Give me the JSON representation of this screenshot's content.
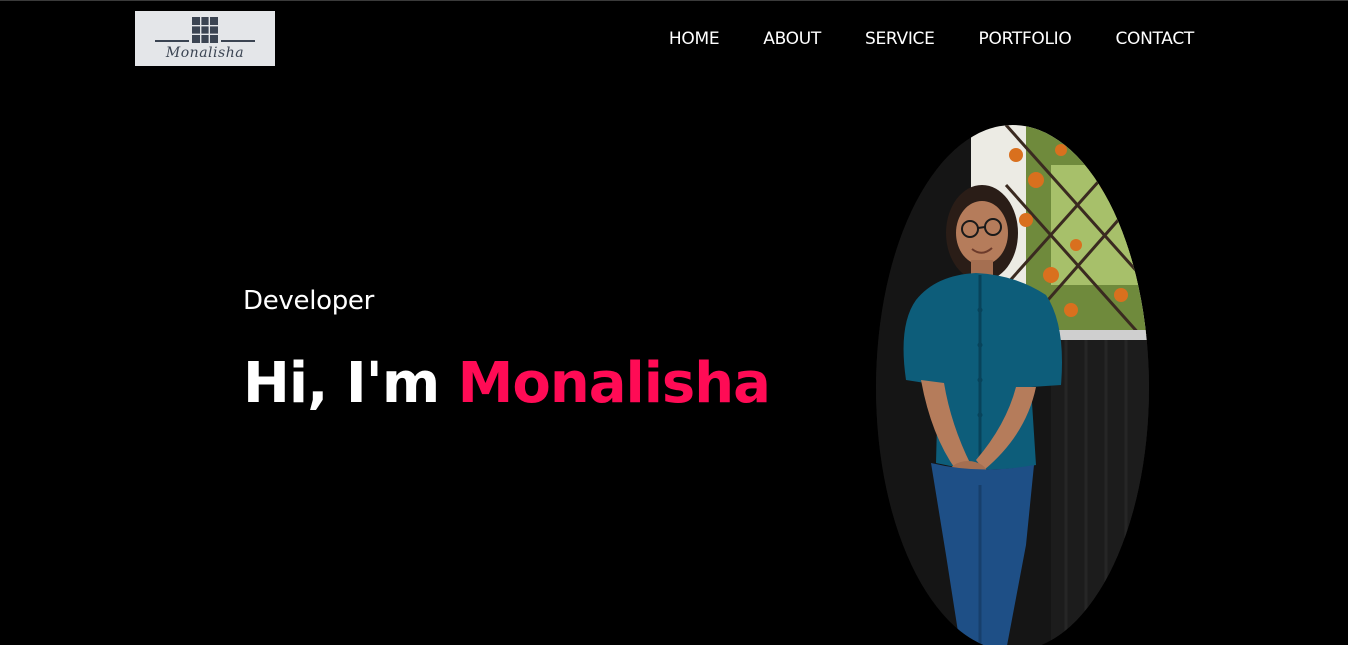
{
  "header": {
    "logo_text": "Monalisha",
    "logo_icon": "grid-icon",
    "nav": [
      "HOME",
      "ABOUT",
      "SERVICE",
      "PORTFOLIO",
      "CONTACT"
    ]
  },
  "hero": {
    "role": "Developer",
    "greeting": "Hi, I'm",
    "name": "Monalisha",
    "photo": "profile-photo"
  },
  "colors": {
    "background": "#000000",
    "accent": "#ff0b55",
    "text": "#ffffff",
    "logo_bg": "#e4e6e9"
  }
}
